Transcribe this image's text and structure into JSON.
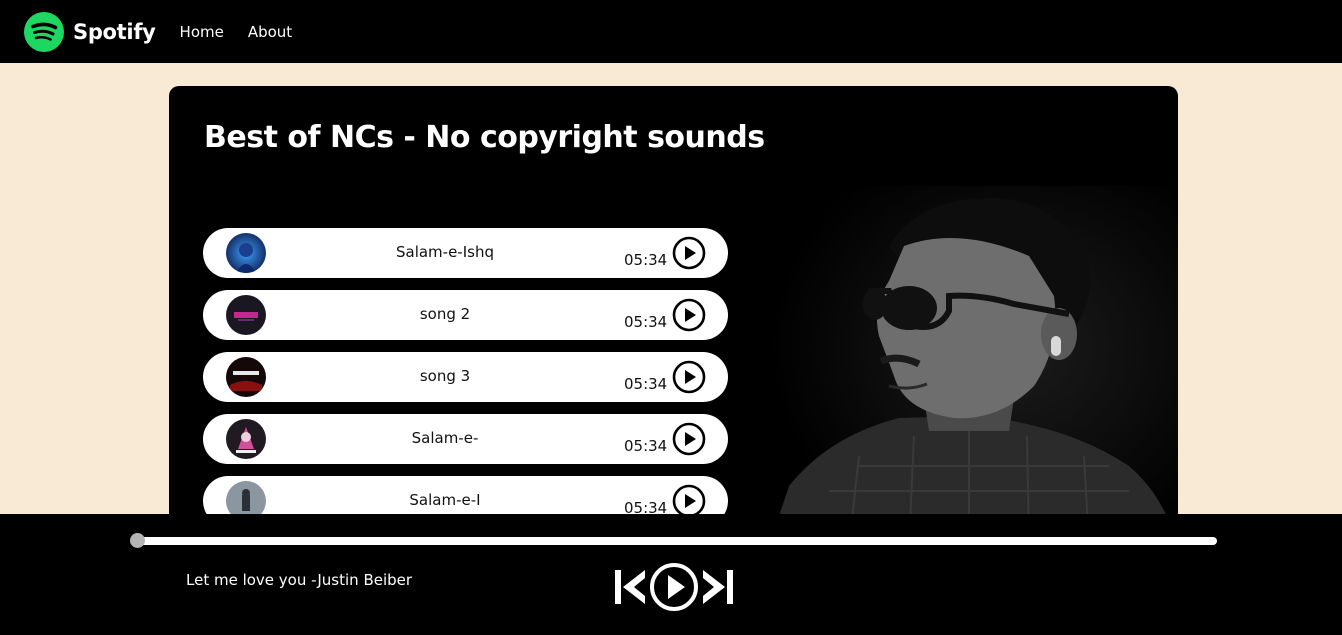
{
  "nav": {
    "brand": "Spotify",
    "links": [
      "Home",
      "About"
    ]
  },
  "playlist": {
    "title": "Best of NCs - No copyright sounds",
    "songs": [
      {
        "name": "Salam-e-Ishq",
        "duration": "05:34"
      },
      {
        "name": "song 2",
        "duration": "05:34"
      },
      {
        "name": "song 3",
        "duration": "05:34"
      },
      {
        "name": "Salam-e-",
        "duration": "05:34"
      },
      {
        "name": "Salam-e-I",
        "duration": "05:34"
      }
    ]
  },
  "player": {
    "now_playing": "Let me love you -Justin Beiber",
    "progress": 0
  },
  "icons": {
    "logo": "spotify-logo-icon",
    "play": "play-circle-icon",
    "previous": "skip-previous-icon",
    "next": "skip-next-icon"
  },
  "colors": {
    "brand_green": "#1ed760",
    "page_bg": "#f9ead5",
    "nav_bg": "#000000"
  }
}
